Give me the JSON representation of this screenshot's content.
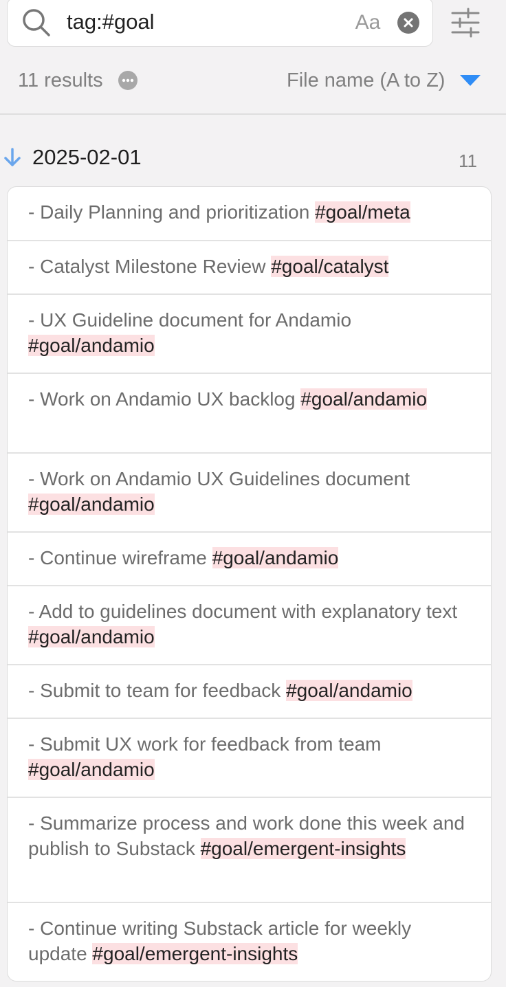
{
  "search": {
    "query": "tag:#goal",
    "match_case_label": "Aa"
  },
  "results_info": {
    "count_label": "11 results",
    "sort_label": "File name (A to Z)"
  },
  "group": {
    "file_name": "2025-02-01",
    "match_count": "11"
  },
  "colors": {
    "background": "#f3f2f3",
    "tag_highlight": "#fce0e2",
    "accent_blue": "#2f8df6"
  },
  "icons": {
    "search": "search-icon",
    "clear": "close-circle-icon",
    "settings": "sliders-icon",
    "more": "more-horizontal-icon",
    "sort": "caret-down-icon",
    "collapse": "arrow-down-icon"
  },
  "results": [
    {
      "text": "- Daily Planning and prioritization ",
      "tag": "#goal/meta"
    },
    {
      "text": "- Catalyst Milestone Review ",
      "tag": "#goal/catalyst"
    },
    {
      "text": "- UX Guideline document for Andamio ",
      "tag": "#goal/andamio"
    },
    {
      "text": "- Work on Andamio UX backlog ",
      "tag": "#goal/andamio"
    },
    {
      "text": "- Work on Andamio UX Guidelines document ",
      "tag": "#goal/andamio"
    },
    {
      "text": "- Continue wireframe ",
      "tag": "#goal/andamio"
    },
    {
      "text": "- Add to guidelines document with explanatory text ",
      "tag": "#goal/andamio"
    },
    {
      "text": "- Submit to team for feedback ",
      "tag": "#goal/andamio"
    },
    {
      "text": "- Submit UX work for feedback from team ",
      "tag": "#goal/andamio"
    },
    {
      "text": "- Summarize process and work done this week and publish to Substack ",
      "tag": "#goal/emergent-insights"
    },
    {
      "text": "- Continue writing Substack article for weekly update ",
      "tag": "#goal/emergent-insights"
    }
  ]
}
